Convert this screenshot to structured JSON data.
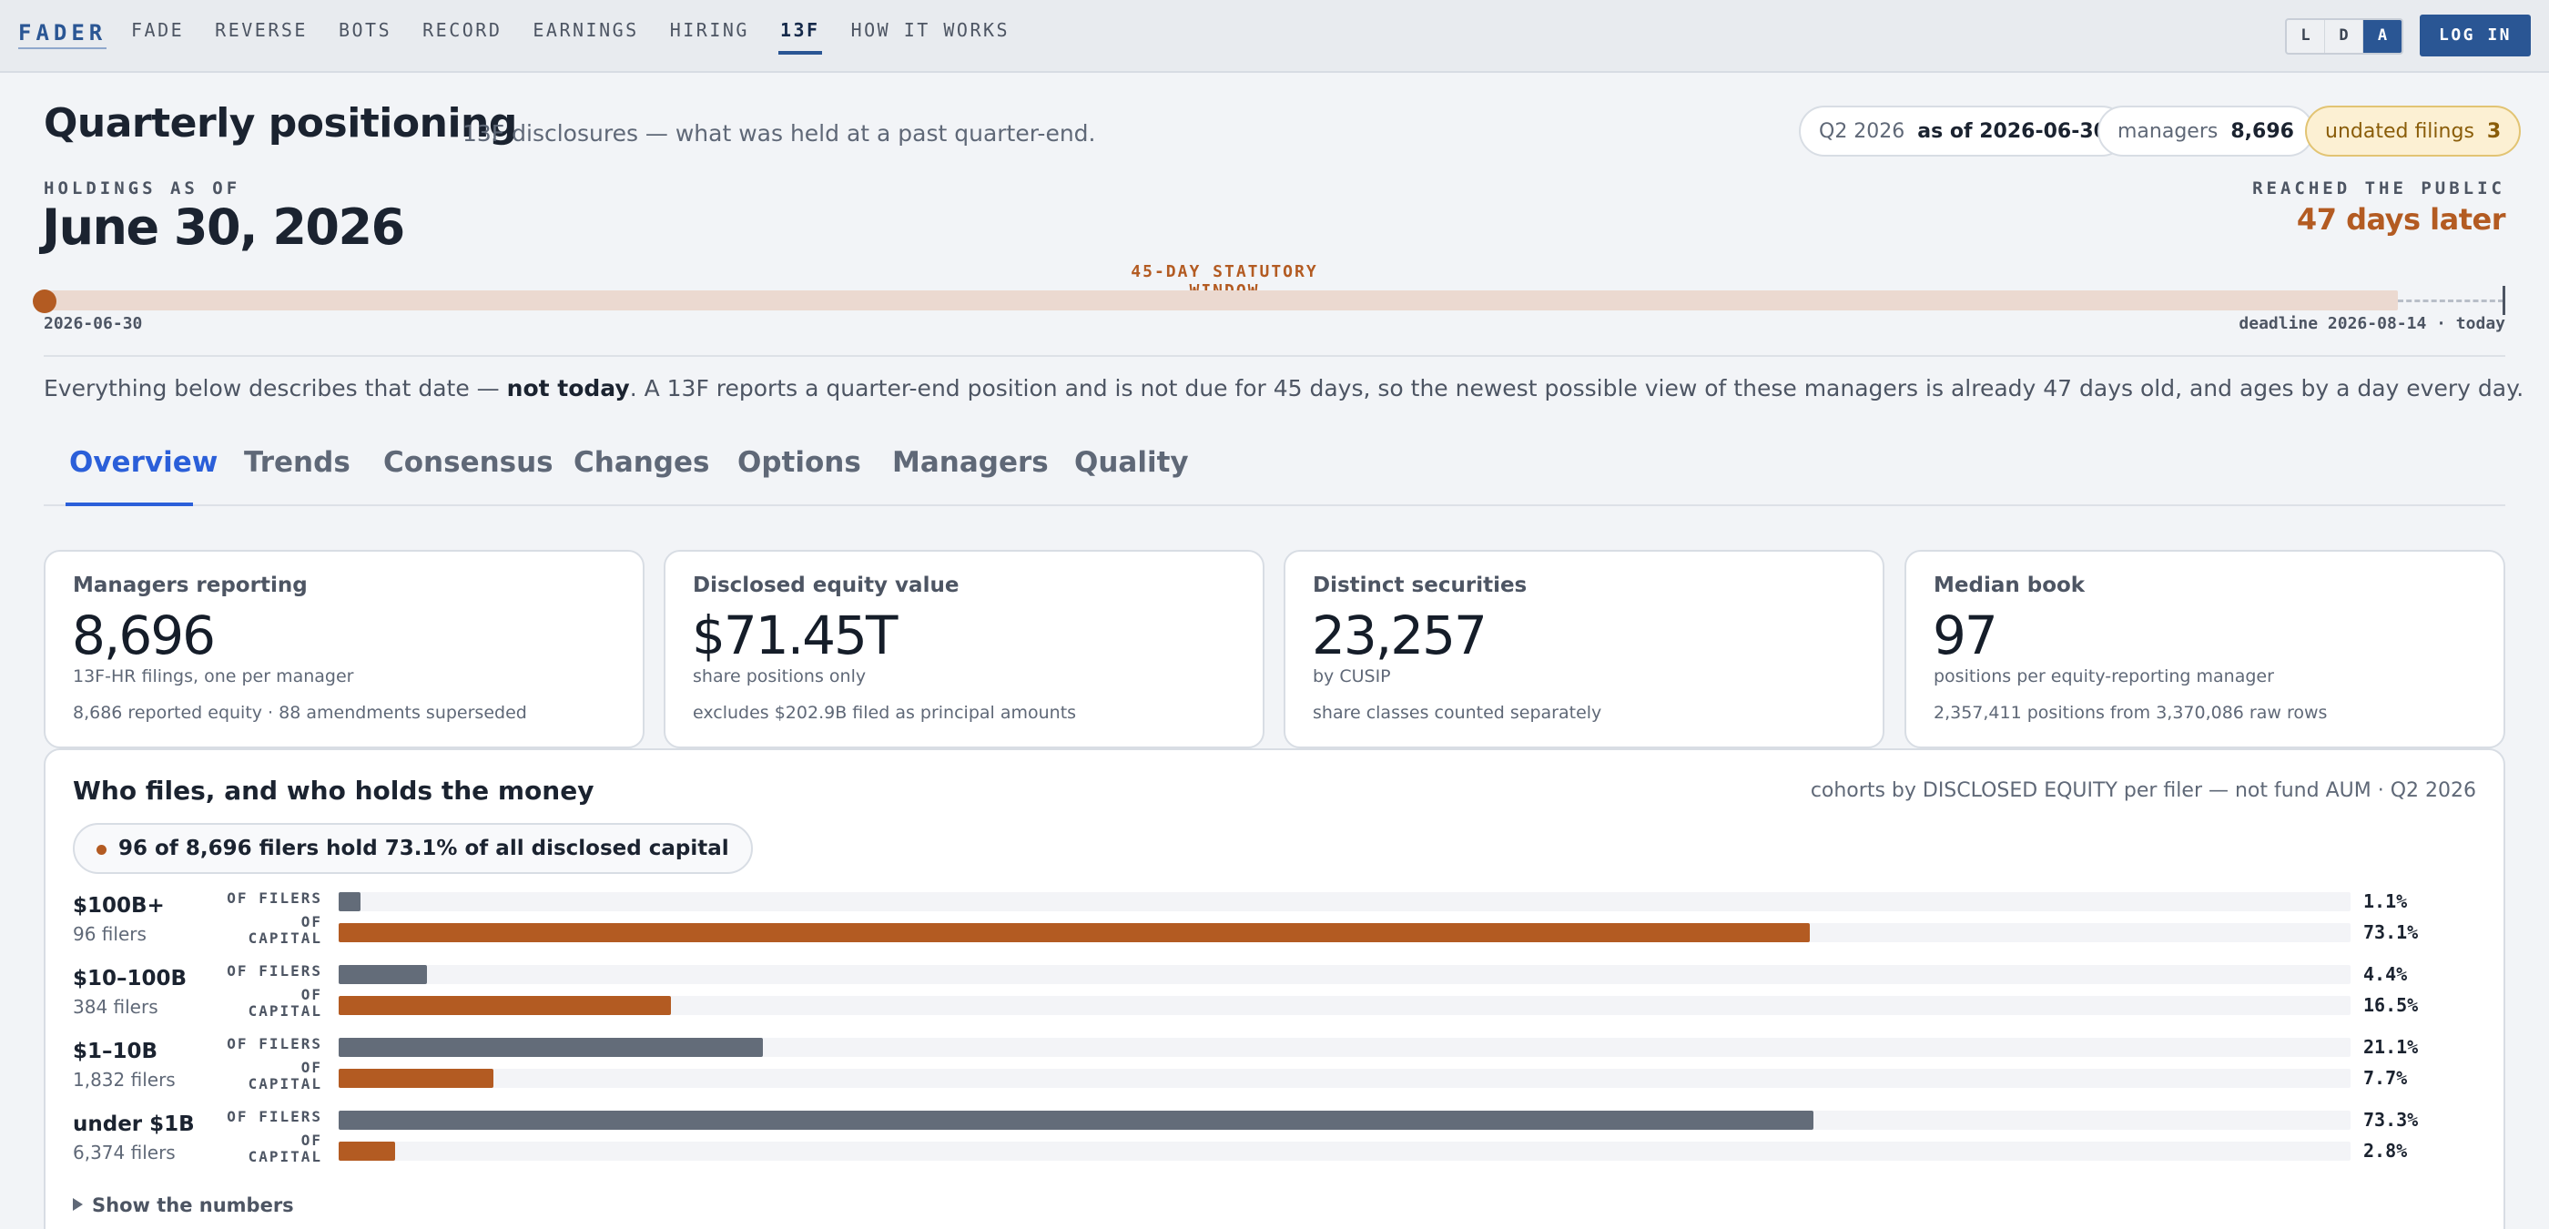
{
  "brand": {
    "logo": "FADER"
  },
  "nav": {
    "items": [
      "FADE",
      "REVERSE",
      "BOTS",
      "RECORD",
      "EARNINGS",
      "HIRING",
      "13F",
      "HOW IT WORKS"
    ],
    "active": "13F"
  },
  "theme_toggle": [
    "L",
    "D",
    "A"
  ],
  "theme_selected": "A",
  "login_label": "LOG IN",
  "header": {
    "title": "Quarterly positioning",
    "subtitle": "13F disclosures — what was held at a past quarter-end."
  },
  "pills": {
    "quarter": {
      "label": "Q2 2026",
      "value": "as of 2026-06-30"
    },
    "managers": {
      "label": "managers",
      "value": "8,696"
    },
    "undated": {
      "label": "undated filings",
      "value": "3"
    }
  },
  "holdings": {
    "eyebrow": "HOLDINGS AS OF",
    "date": "June 30, 2026",
    "reached_eyebrow": "REACHED THE PUBLIC",
    "reached_value": "47 days later"
  },
  "timeline": {
    "window_label": "45-DAY STATUTORY WINDOW",
    "start_date": "2026-06-30",
    "end_label": "deadline 2026-08-14 · today"
  },
  "explainer": {
    "before": "Everything below describes that date — ",
    "strong": "not today",
    "after": ". A 13F reports a quarter-end position and is not due for 45 days, so the newest possible view of these managers is already 47 days old, and ages by a day every day."
  },
  "tabs": [
    "Overview",
    "Trends",
    "Consensus",
    "Changes",
    "Options",
    "Managers",
    "Quality"
  ],
  "active_tab": "Overview",
  "stats": [
    {
      "label": "Managers reporting",
      "value": "8,696",
      "sub": "13F-HR filings, one per manager",
      "note": "8,686 reported equity · 88 amendments superseded"
    },
    {
      "label": "Disclosed equity value",
      "value": "$71.45T",
      "sub": "share positions only",
      "note": "excludes $202.9B filed as principal amounts"
    },
    {
      "label": "Distinct securities",
      "value": "23,257",
      "sub": "by CUSIP",
      "note": "share classes counted separately"
    },
    {
      "label": "Median book",
      "value": "97",
      "sub": "positions per equity-reporting manager",
      "note": "2,357,411 positions from 3,370,086 raw rows"
    }
  ],
  "cohorts_panel": {
    "title": "Who files, and who holds the money",
    "meta": "cohorts by DISCLOSED EQUITY per filer — not fund AUM · Q2 2026",
    "callout": "96 of 8,696 filers hold 73.1% of all disclosed capital",
    "filers_label": "OF FILERS",
    "capital_label_1": "OF",
    "capital_label_2": "CAPITAL",
    "show_numbers": "Show the numbers",
    "cohorts": [
      {
        "name": "$100B+",
        "count": "96 filers",
        "filers_pct": 1.1,
        "capital_pct": 73.1,
        "filers_text": "1.1%",
        "capital_text": "73.1%"
      },
      {
        "name": "$10–100B",
        "count": "384 filers",
        "filers_pct": 4.4,
        "capital_pct": 16.5,
        "filers_text": "4.4%",
        "capital_text": "16.5%"
      },
      {
        "name": "$1–10B",
        "count": "1,832 filers",
        "filers_pct": 21.1,
        "capital_pct": 7.7,
        "filers_text": "21.1%",
        "capital_text": "7.7%"
      },
      {
        "name": "under $1B",
        "count": "6,374 filers",
        "filers_pct": 73.3,
        "capital_pct": 2.8,
        "filers_text": "73.3%",
        "capital_text": "2.8%"
      }
    ]
  },
  "colors": {
    "accent": "#2a5694",
    "tab_active": "#2b5fd9",
    "capital": "#b35b22",
    "filers": "#636c79",
    "warning_bg": "#fcf0d3"
  }
}
